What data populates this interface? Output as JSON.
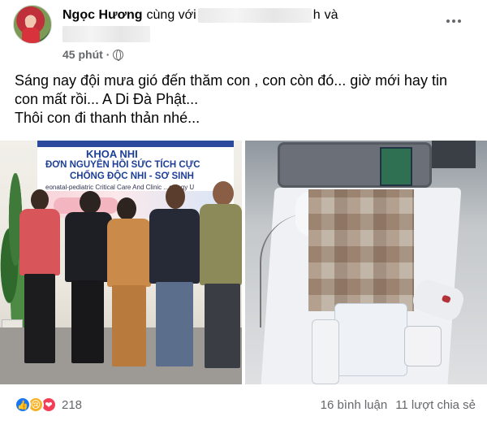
{
  "post": {
    "author": "Ngọc Hương",
    "with_word": "cùng với",
    "tagged_name_tail": "h",
    "and_word": "và",
    "time": "45 phút",
    "time_separator": "·",
    "privacy_icon": "globe-icon",
    "more_icon": "more-horizontal-icon",
    "text_lines": [
      "Sáng nay đội mưa gió đến thăm con , con còn đó... giờ mới hay tin",
      "con mất rồi... A Di Đà Phật...",
      "Thôi con đi thanh thản nhé..."
    ]
  },
  "photos": {
    "left": {
      "banner_title": "KHOA NHI",
      "banner_line2": "ĐƠN NGUYÊN HỒI SỨC TÍCH CỰC",
      "banner_line3": "CHỐNG ĐỘC NHI - SƠ SINH",
      "banner_line4": "eonatal-pediatric Critical Care And Clinic  ...cology U"
    }
  },
  "engagement": {
    "reaction_icons": [
      "like-icon",
      "sad-icon",
      "love-icon"
    ],
    "reaction_count": "218",
    "comments": "16 bình luận",
    "shares": "11 lượt chia sẻ"
  },
  "colors": {
    "like": "#1877f2",
    "sad": "#f7b125",
    "love": "#f33e58",
    "secondary_text": "#65676b",
    "banner_blue": "#1d3f98"
  }
}
